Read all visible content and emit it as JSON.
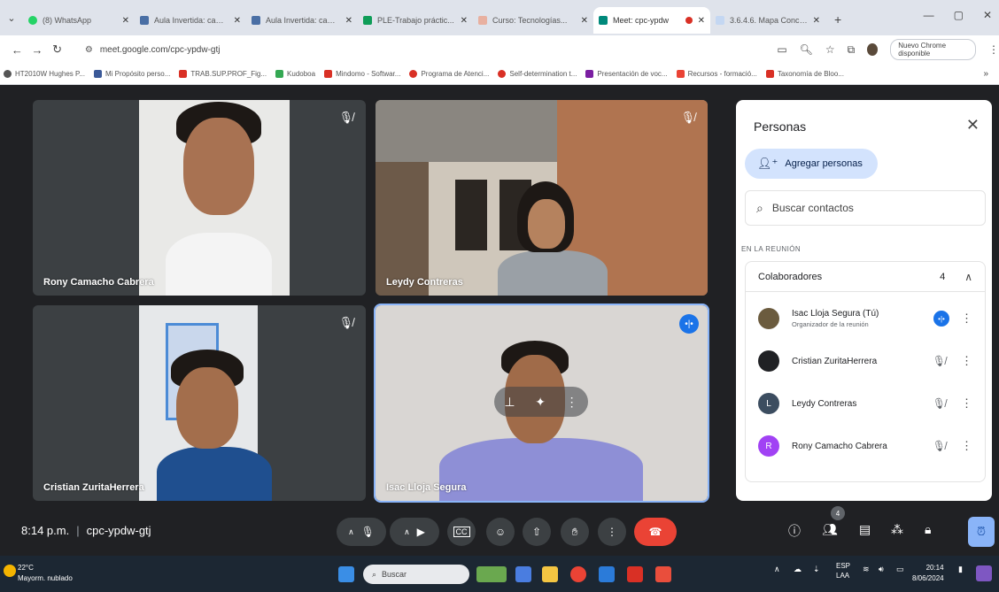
{
  "browser": {
    "tabs": [
      {
        "title": "(8) WhatsApp",
        "color": "#25d366"
      },
      {
        "title": "Aula Invertida: cam...",
        "color": "#4a6fa5"
      },
      {
        "title": "Aula Invertida: cam...",
        "color": "#4a6fa5"
      },
      {
        "title": "PLE-Trabajo práctic...",
        "color": "#0f9d58"
      },
      {
        "title": "Curso: Tecnologías...",
        "color": "#e8b0a0"
      },
      {
        "title": "Meet: cpc-ypdw",
        "color": "#00897b"
      },
      {
        "title": "3.6.4.6. Mapa Conce...",
        "color": "#c4d7f2"
      }
    ],
    "url": "meet.google.com/cpc-ypdw-gtj",
    "update_label": "Nuevo Chrome disponible",
    "bookmarks": [
      {
        "label": "HT2010W Hughes P...",
        "color": "#555"
      },
      {
        "label": "Mi Propósito perso...",
        "color": "#3b5998"
      },
      {
        "label": "TRAB.SUP.PROF_Fig...",
        "color": "#d93025"
      },
      {
        "label": "Kudoboa",
        "color": "#34a853"
      },
      {
        "label": "Mindomo - Softwar...",
        "color": "#d93025"
      },
      {
        "label": "Programa de Atenci...",
        "color": "#d93025"
      },
      {
        "label": "Self-determination t...",
        "color": "#d93025"
      },
      {
        "label": "Presentación de voc...",
        "color": "#7b1fa2"
      },
      {
        "label": "Recursos - formació...",
        "color": "#ea4335"
      },
      {
        "label": "Taxonomía de Bloo...",
        "color": "#d93025"
      }
    ]
  },
  "tiles": [
    {
      "name": "Rony Camacho Cabrera"
    },
    {
      "name": "Leydy Contreras"
    },
    {
      "name": "Cristian ZuritaHerrera"
    },
    {
      "name": "Isac Lloja Segura"
    }
  ],
  "panel": {
    "title": "Personas",
    "add_label": "Agregar personas",
    "search_placeholder": "Buscar contactos",
    "section_label": "EN LA REUNIÓN",
    "group_label": "Colaboradores",
    "group_count": "4",
    "people": [
      {
        "name": "Isac Lloja Segura (Tú)",
        "sub": "Organizador de la reunión",
        "initial": "",
        "color": "#6b5b3e"
      },
      {
        "name": "Cristian ZuritaHerrera",
        "sub": "",
        "initial": "",
        "color": "#202124"
      },
      {
        "name": "Leydy Contreras",
        "sub": "",
        "initial": "L",
        "color": "#3c4d60"
      },
      {
        "name": "Rony Camacho Cabrera",
        "sub": "",
        "initial": "R",
        "color": "#a142f4"
      }
    ]
  },
  "meeting": {
    "time": "8:14 p.m.",
    "code": "cpc-ypdw-gtj",
    "participant_badge": "4"
  },
  "taskbar": {
    "temp": "22°C",
    "weather": "Mayorm. nublado",
    "search": "Buscar",
    "lang1": "ESP",
    "lang2": "LAA",
    "clock_time": "20:14",
    "clock_date": "8/06/2024"
  }
}
